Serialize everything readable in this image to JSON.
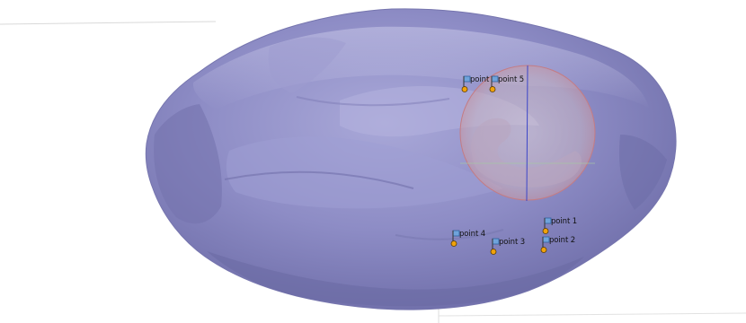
{
  "scene": {
    "object": "asteroid-mesh",
    "mesh_color": "#8c8cc4",
    "highlight_color": "#b7b6dd",
    "shadow_color": "#6d6da6",
    "sphere_edge_color": "#c67f86",
    "sphere_fill_color": "#c9b8c4",
    "axis_line_color": "#3b45c8",
    "marker_pin_color": "#f0a20b",
    "marker_flag_color": "#6fa3db"
  },
  "markers": [
    {
      "id": "point-6",
      "label": "point 6"
    },
    {
      "id": "point-5",
      "label": "point 5"
    },
    {
      "id": "point-1",
      "label": "point 1"
    },
    {
      "id": "point-2",
      "label": "point 2"
    },
    {
      "id": "point-4",
      "label": "point 4"
    },
    {
      "id": "point-3",
      "label": "point 3"
    }
  ]
}
